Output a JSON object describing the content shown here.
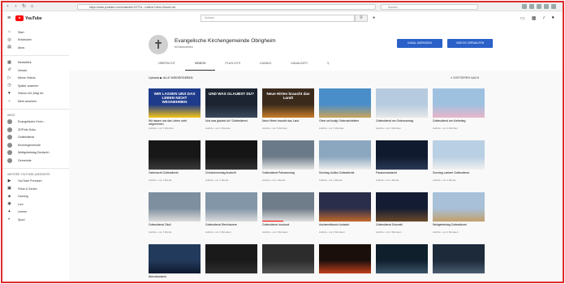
{
  "browser": {
    "url": "https://www.youtube.com/channel/UCf7Fa.../videos?view=0&sort=dd",
    "search_placeholder": "Suchen"
  },
  "header": {
    "logo_text": "YouTube",
    "search_placeholder": "Suchen"
  },
  "sidebar": {
    "main": [
      {
        "icon": "home-icon",
        "glyph": "⌂",
        "label": "Start"
      },
      {
        "icon": "explore-icon",
        "glyph": "◎",
        "label": "Entdecken"
      },
      {
        "icon": "subscriptions-icon",
        "glyph": "▤",
        "label": "Abos"
      }
    ],
    "library": [
      {
        "icon": "library-icon",
        "glyph": "▦",
        "label": "Mediathek"
      },
      {
        "icon": "history-icon",
        "glyph": "↺",
        "label": "Verlauf"
      },
      {
        "icon": "your-videos-icon",
        "glyph": "▷",
        "label": "Meine Videos"
      },
      {
        "icon": "watch-later-icon",
        "glyph": "◷",
        "label": "Später ansehen"
      },
      {
        "icon": "liked-icon",
        "glyph": "♥",
        "label": "Videos mit „Mag ich"
      },
      {
        "icon": "chevron-down-icon",
        "glyph": "⌄",
        "label": "Mehr ansehen"
      }
    ],
    "section_abos": "Abos",
    "subscriptions": [
      {
        "label": "Evangelische Kirch..."
      },
      {
        "label": "ZDFinfo Doku"
      },
      {
        "label": "Gottesdienst"
      },
      {
        "label": "Kirchengemeinde"
      },
      {
        "label": "Weltgebetstag Deutschl..."
      },
      {
        "label": "Gemeinde"
      }
    ],
    "section_more": "Weitere YouTube-Angebote",
    "more": [
      {
        "icon": "premium-icon",
        "glyph": "▶",
        "label": "YouTube Premium"
      },
      {
        "icon": "films-icon",
        "glyph": "▣",
        "label": "Filme & Serien"
      },
      {
        "icon": "gaming-icon",
        "glyph": "◈",
        "label": "Gaming"
      },
      {
        "icon": "live-icon",
        "glyph": "◉",
        "label": "Live"
      },
      {
        "icon": "learn-icon",
        "glyph": "✦",
        "label": "Lernen"
      },
      {
        "icon": "sports-icon",
        "glyph": "◐",
        "label": "Sport"
      }
    ]
  },
  "channel": {
    "name": "Evangelische Kirchengemeinde Obrigheim",
    "subscribers": "63 Abonnenten",
    "btn_customize": "KANAL ANPASSEN",
    "btn_studio": "VIDEOS VERWALTEN",
    "tabs": [
      "Übersicht",
      "Videos",
      "Playlists",
      "Kanäle",
      "Kanalinfo"
    ]
  },
  "content": {
    "uploads_label": "Uploads  ▶ ALLE WIEDERGEBEN",
    "sort_label": "SORTIEREN NACH"
  },
  "videos": [
    {
      "title": "Wir lassen uns das Leben nicht wegnehmen",
      "meta": "Aufrufe • vor 2 Wochen",
      "bg": "#1e3a8a",
      "bg2": "#f5c518",
      "text": "WIR LASSEN UNS DAS LEBEN NICHT WEGNEHMEN",
      "progress": 0
    },
    {
      "title": "Und was glaubst du? Gottesdienst",
      "meta": "Aufrufe • vor 2 Wochen",
      "bg": "#1b2430",
      "bg2": "#3b4a5c",
      "text": "UND WAS GLAUBST DU?",
      "progress": 0
    },
    {
      "title": "Neue Hirten braucht das Land",
      "meta": "Aufrufe • vor 3 Wochen",
      "bg": "#3a2a1c",
      "bg2": "#c87d2a",
      "text": "Neue Hirten braucht das Land!",
      "progress": 0
    },
    {
      "title": "Ohne sei lustig! Osternachtsfeier",
      "meta": "Aufrufe • vor 3 Wochen",
      "bg": "#4a8ec9",
      "bg2": "#c9a45a",
      "text": "",
      "progress": 0
    },
    {
      "title": "Gottesdienst am Ostersonntag",
      "meta": "Aufrufe • vor 3 Wochen",
      "bg": "#b7cbe0",
      "bg2": "#e8e8e8",
      "text": "",
      "progress": 0
    },
    {
      "title": "Gottesdienst am Karfreitag",
      "meta": "Aufrufe • vor 3 Wochen",
      "bg": "#9fc1e0",
      "bg2": "#e9b6c9",
      "text": "",
      "progress": 0
    },
    {
      "title": "Osternacht Gottesdienst",
      "meta": "Aufrufe • vor 1 Monat",
      "bg": "#171717",
      "bg2": "#3a3a3a",
      "text": "",
      "progress": 0
    },
    {
      "title": "Gründonnerstag Andacht",
      "meta": "Aufrufe • vor 1 Monat",
      "bg": "#151515",
      "bg2": "#333333",
      "text": "",
      "progress": 0
    },
    {
      "title": "Gottesdienst Palmsonntag",
      "meta": "Aufrufe • vor 1 Monat",
      "bg": "#6b7a88",
      "bg2": "#e5e5e5",
      "text": "",
      "progress": 0
    },
    {
      "title": "Sonntag Judika Gottesdienst",
      "meta": "Aufrufe • vor 1 Monat",
      "bg": "#8ba6bf",
      "bg2": "#eeeeee",
      "text": "",
      "progress": 0
    },
    {
      "title": "Passionsandacht",
      "meta": "Aufrufe • vor 1 Monat",
      "bg": "#0f1a2e",
      "bg2": "#2a3a55",
      "text": "",
      "progress": 0
    },
    {
      "title": "Sonntag Laetare Gottesdienst",
      "meta": "Aufrufe • vor 1 Monat",
      "bg": "#b9cfe3",
      "bg2": "#f0f0f0",
      "text": "",
      "progress": 0
    },
    {
      "title": "Gottesdienst Okuli",
      "meta": "Aufrufe • vor 1 Monat",
      "bg": "#7e8f9f",
      "bg2": "#dcdcdc",
      "text": "",
      "progress": 0
    },
    {
      "title": "Gottesdienst Reminiszere",
      "meta": "Aufrufe • vor 2 Monaten",
      "bg": "#8296a8",
      "bg2": "#dadada",
      "text": "",
      "progress": 0
    },
    {
      "title": "Gottesdienst Invokavit",
      "meta": "Aufrufe • vor 2 Monaten",
      "bg": "#6f7c89",
      "bg2": "#e0e0e0",
      "text": "",
      "progress": 0.4
    },
    {
      "title": "Aschermittwoch Andacht",
      "meta": "Aufrufe • vor 2 Monaten",
      "bg": "#2b2e4a",
      "bg2": "#c46a2c",
      "text": "",
      "progress": 0
    },
    {
      "title": "Gottesdienst Estomihi",
      "meta": "Aufrufe • vor 2 Monaten",
      "bg": "#141c33",
      "bg2": "#6c4a2a",
      "text": "",
      "progress": 0
    },
    {
      "title": "Weltgebetstag Gottesdienst",
      "meta": "Aufrufe • vor 2 Monaten",
      "bg": "#a8c0d8",
      "bg2": "#c2a06a",
      "text": "",
      "progress": 0
    },
    {
      "title": "Abendandacht",
      "meta": "",
      "bg": "#223a5c",
      "bg2": "#0f1a2e",
      "text": "",
      "progress": 0
    },
    {
      "title": "",
      "meta": "",
      "bg": "#1a1a1a",
      "bg2": "#2f2f2f",
      "text": "",
      "progress": 0
    },
    {
      "title": "",
      "meta": "",
      "bg": "#2c2c2c",
      "bg2": "#555555",
      "text": "",
      "progress": 0
    },
    {
      "title": "",
      "meta": "",
      "bg": "#1a0f0a",
      "bg2": "#c2401c",
      "text": "",
      "progress": 0
    },
    {
      "title": "",
      "meta": "",
      "bg": "#0f1f2c",
      "bg2": "#3d5468",
      "text": "",
      "progress": 0
    },
    {
      "title": "",
      "meta": "",
      "bg": "#1c2a3a",
      "bg2": "#4a5d70",
      "text": "",
      "progress": 0
    }
  ]
}
